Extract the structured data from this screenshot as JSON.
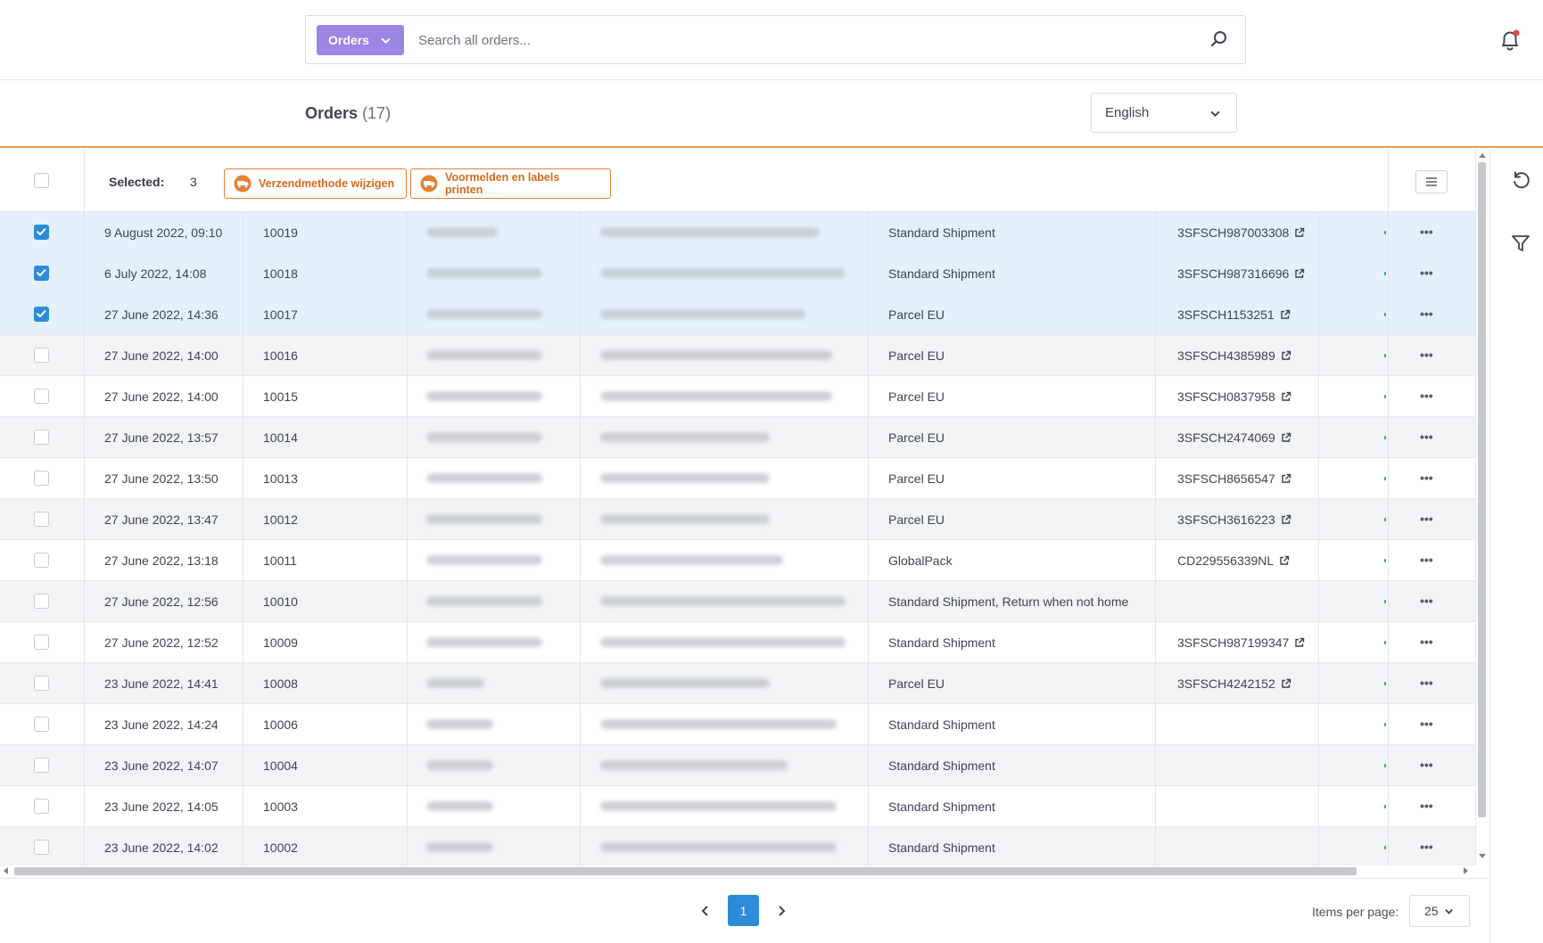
{
  "search": {
    "scope_label": "Orders",
    "placeholder": "Search all orders...",
    "value": ""
  },
  "header": {
    "title": "Orders",
    "count": "(17)",
    "language": "English"
  },
  "toolbar": {
    "selected_label": "Selected:",
    "selected_count": "3",
    "btn_shipping": "Verzendmethode wijzigen",
    "btn_labels": "Voormelden en labels printen"
  },
  "colors": {
    "accent": "#2d8bd7",
    "scope_button": "#9a86e3",
    "bulk_action": "#e57f34",
    "selected_row": "#e4f0fb"
  },
  "rows": [
    {
      "checked": true,
      "date": "9 August 2022, 09:10",
      "order": "10019",
      "method": "Standard Shipment",
      "tracking": "3SFSCH987003308",
      "has_link": true
    },
    {
      "checked": true,
      "date": "6 July 2022, 14:08",
      "order": "10018",
      "method": "Standard Shipment",
      "tracking": "3SFSCH987316696",
      "has_link": true
    },
    {
      "checked": true,
      "date": "27 June 2022, 14:36",
      "order": "10017",
      "method": "Parcel EU",
      "tracking": "3SFSCH1153251",
      "has_link": true
    },
    {
      "checked": false,
      "date": "27 June 2022, 14:00",
      "order": "10016",
      "method": "Parcel EU",
      "tracking": "3SFSCH4385989",
      "has_link": true
    },
    {
      "checked": false,
      "date": "27 June 2022, 14:00",
      "order": "10015",
      "method": "Parcel EU",
      "tracking": "3SFSCH0837958",
      "has_link": true
    },
    {
      "checked": false,
      "date": "27 June 2022, 13:57",
      "order": "10014",
      "method": "Parcel EU",
      "tracking": "3SFSCH2474069",
      "has_link": true
    },
    {
      "checked": false,
      "date": "27 June 2022, 13:50",
      "order": "10013",
      "method": "Parcel EU",
      "tracking": "3SFSCH8656547",
      "has_link": true
    },
    {
      "checked": false,
      "date": "27 June 2022, 13:47",
      "order": "10012",
      "method": "Parcel EU",
      "tracking": "3SFSCH3616223",
      "has_link": true
    },
    {
      "checked": false,
      "date": "27 June 2022, 13:18",
      "order": "10011",
      "method": "GlobalPack",
      "tracking": "CD229556339NL",
      "has_link": true
    },
    {
      "checked": false,
      "date": "27 June 2022, 12:56",
      "order": "10010",
      "method": "Standard Shipment, Return when not home",
      "tracking": "",
      "has_link": false
    },
    {
      "checked": false,
      "date": "27 June 2022, 12:52",
      "order": "10009",
      "method": "Standard Shipment",
      "tracking": "3SFSCH987199347",
      "has_link": true
    },
    {
      "checked": false,
      "date": "23 June 2022, 14:41",
      "order": "10008",
      "method": "Parcel EU",
      "tracking": "3SFSCH4242152",
      "has_link": true
    },
    {
      "checked": false,
      "date": "23 June 2022, 14:24",
      "order": "10006",
      "method": "Standard Shipment",
      "tracking": "",
      "has_link": false
    },
    {
      "checked": false,
      "date": "23 June 2022, 14:07",
      "order": "10004",
      "method": "Standard Shipment",
      "tracking": "",
      "has_link": false
    },
    {
      "checked": false,
      "date": "23 June 2022, 14:05",
      "order": "10003",
      "method": "Standard Shipment",
      "tracking": "",
      "has_link": false
    },
    {
      "checked": false,
      "date": "23 June 2022, 14:02",
      "order": "10002",
      "method": "Standard Shipment",
      "tracking": "",
      "has_link": false
    }
  ],
  "more_label": "•••",
  "pagination": {
    "current_page": "1",
    "items_per_page_label": "Items per page:",
    "items_per_page": "25"
  }
}
